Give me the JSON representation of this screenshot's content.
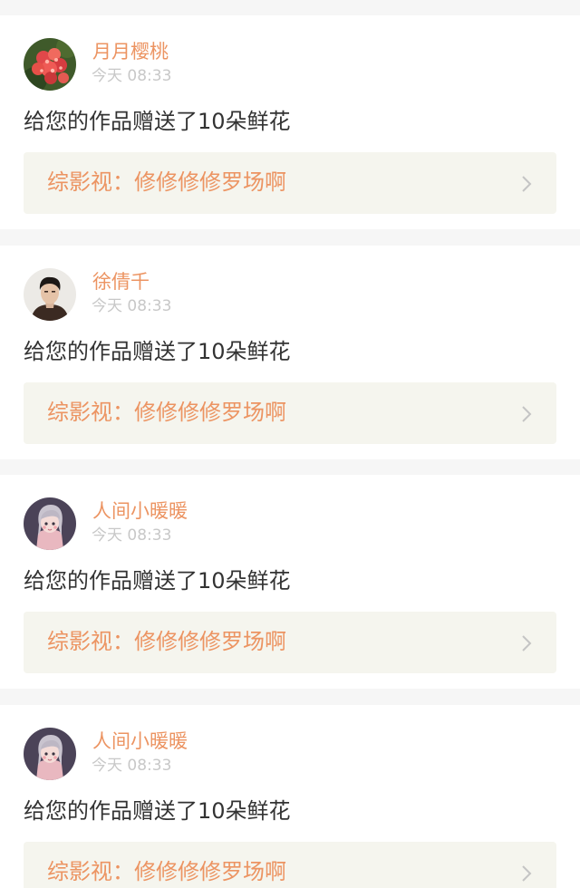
{
  "colors": {
    "accent": "#ec9462",
    "page_background": "#f6f6f6",
    "link_background": "#f5f5ee",
    "body_text": "#333333",
    "time_text": "#c8c8c8",
    "chevron": "#c4c4c4"
  },
  "notifications": [
    {
      "avatar_icon": "red-flower-avatar-icon",
      "username": "月月樱桃",
      "time": "今天 08:33",
      "message": "给您的作品赠送了10朵鲜花",
      "work_link": "综影视：修修修修罗场啊"
    },
    {
      "avatar_icon": "young-man-portrait-avatar-icon",
      "username": "徐倩千",
      "time": "今天 08:33",
      "message": "给您的作品赠送了10朵鲜花",
      "work_link": "综影视：修修修修罗场啊"
    },
    {
      "avatar_icon": "cartoon-girl-avatar-icon",
      "username": "人间小暖暖",
      "time": "今天 08:33",
      "message": "给您的作品赠送了10朵鲜花",
      "work_link": "综影视：修修修修罗场啊"
    },
    {
      "avatar_icon": "cartoon-girl-avatar-icon",
      "username": "人间小暖暖",
      "time": "今天 08:33",
      "message": "给您的作品赠送了10朵鲜花",
      "work_link": "综影视：修修修修罗场啊"
    }
  ]
}
